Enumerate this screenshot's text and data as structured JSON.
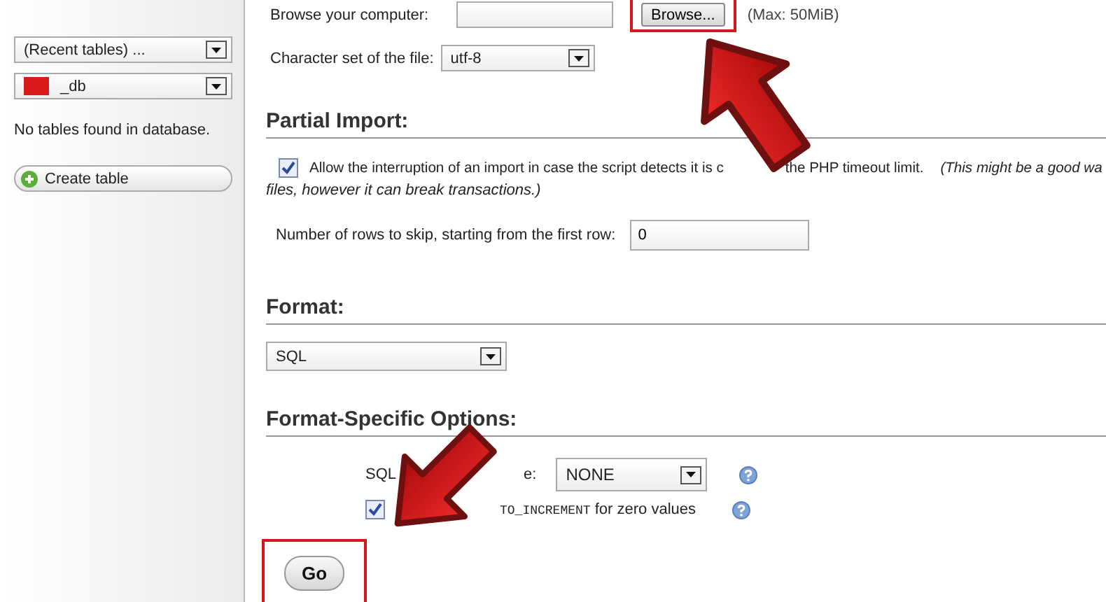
{
  "sidebar": {
    "selects": [
      {
        "value": "(Recent tables) ...",
        "redacted": false
      },
      {
        "value": "_db",
        "redacted": true
      }
    ],
    "message": "No tables found in database.",
    "create_button": "Create table"
  },
  "file_upload": {
    "label": "Browse your computer:",
    "button": "Browse...",
    "max": "(Max: 50MiB)",
    "highlighted": true
  },
  "charset": {
    "label": "Character set of the file:",
    "value": "utf-8"
  },
  "partial_import": {
    "title": "Partial Import:",
    "allow_interruption": {
      "checked": true,
      "text_start": "Allow the interruption of an import in case the script detects it is c",
      "text_end": "the PHP timeout limit.",
      "note_start": "(This might be a good wa",
      "note_end": "files, however it can break transactions.)"
    },
    "skip_rows": {
      "label": "Number of rows to skip, starting from the first row:",
      "value": "0"
    }
  },
  "format": {
    "title": "Format:",
    "value": "SQL"
  },
  "format_options": {
    "title": "Format-Specific Options:",
    "compat": {
      "label_start": "SQL",
      "label_end": "e:",
      "value": "NONE"
    },
    "auto_increment": {
      "checked": true,
      "code": "TO_INCREMENT",
      "text": "for zero values"
    }
  },
  "go": {
    "label": "Go",
    "highlighted": true
  }
}
